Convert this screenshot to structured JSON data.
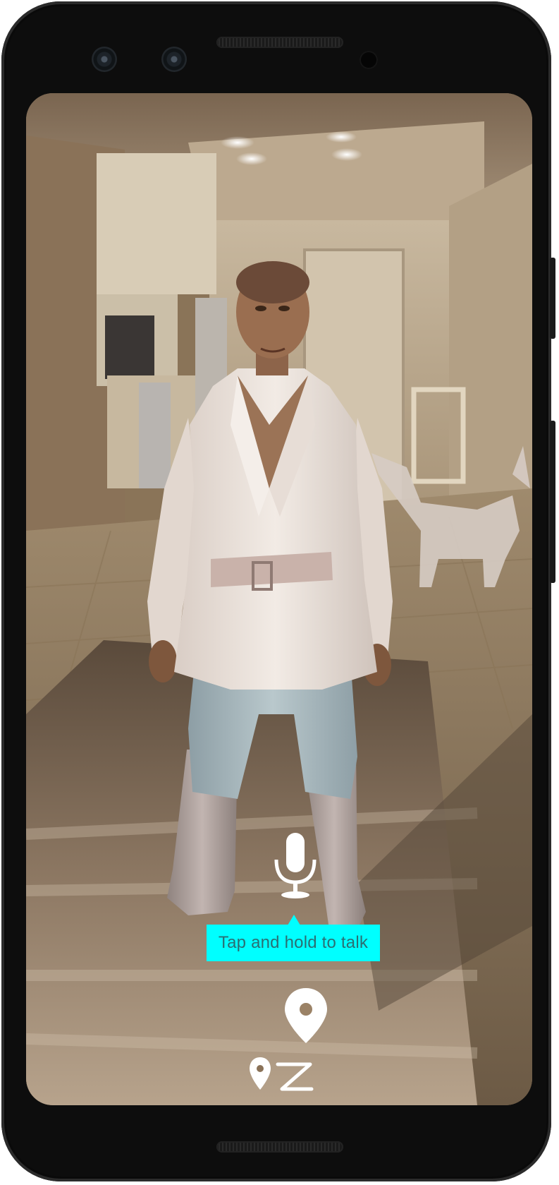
{
  "screen": {
    "tooltip_text": "Tap and hold to talk",
    "tooltip_color": "#00ffff",
    "tooltip_text_color": "#2a6f73",
    "mic_icon": "microphone-icon",
    "route_icon": "route-navigation-icon"
  },
  "scene": {
    "description_icon": "ar-avatar-scene"
  }
}
